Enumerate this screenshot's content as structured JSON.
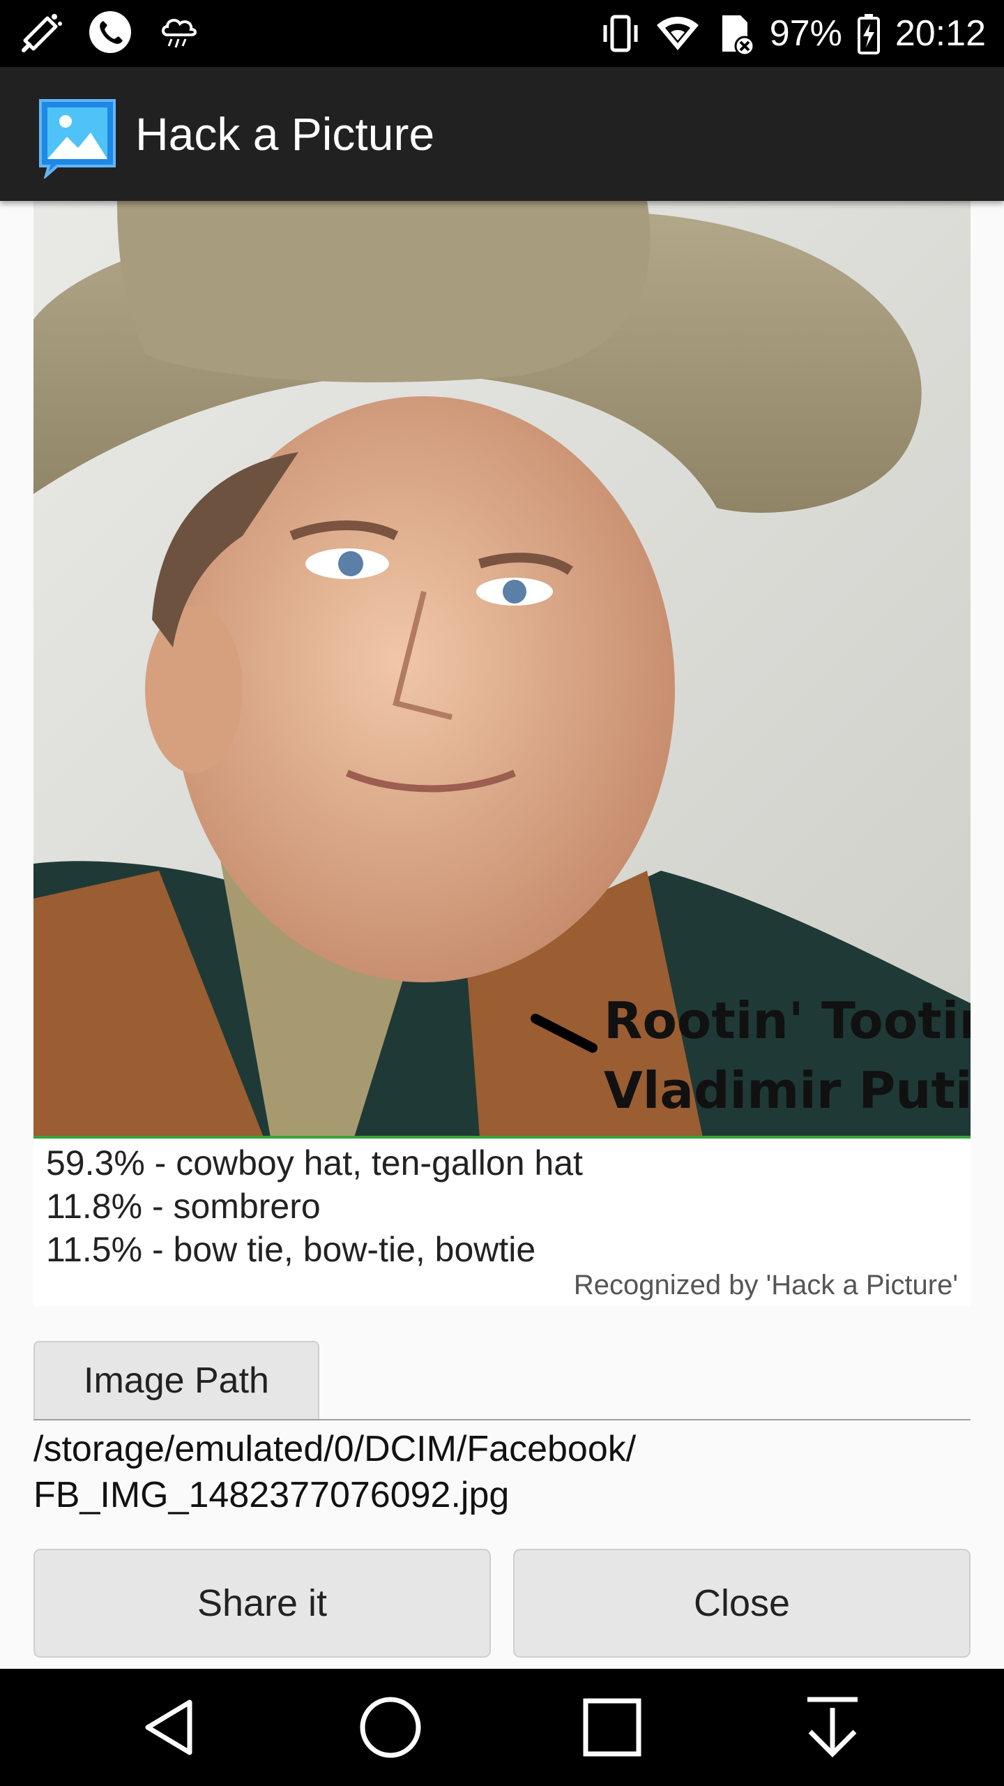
{
  "status_bar": {
    "battery_percent": "97%",
    "time": "20:12",
    "left_icons": [
      "megaphone-icon",
      "phone-icon",
      "rain-cloud-icon"
    ],
    "right_icons": [
      "vibrate-icon",
      "wifi-icon",
      "sd-card-error-icon",
      "battery-charging-icon"
    ]
  },
  "app_bar": {
    "title": "Hack a Picture",
    "logo_icon": "picture-icon"
  },
  "photo": {
    "caption_line1": "Rootin' Tootin'",
    "caption_line2": "Vladimir Putin"
  },
  "results": {
    "items": [
      "59.3% - cowboy hat, ten-gallon hat",
      "11.8% - sombrero",
      "11.5% - bow tie, bow-tie, bowtie"
    ],
    "credit": "Recognized by 'Hack a Picture'"
  },
  "image_path": {
    "tab_label": "Image Path",
    "path_line1": "/storage/emulated/0/DCIM/Facebook/",
    "path_line2": "FB_IMG_1482377076092.jpg"
  },
  "actions": {
    "share_label": "Share it",
    "close_label": "Close"
  },
  "nav_bar": {
    "buttons": [
      "back-icon",
      "home-icon",
      "recents-icon",
      "download-icon"
    ]
  },
  "colors": {
    "status_bar_bg": "#000000",
    "app_bar_bg": "#212121",
    "content_bg": "#fafafa",
    "divider_green": "#3aa33a",
    "button_bg": "#e6e6e6"
  }
}
